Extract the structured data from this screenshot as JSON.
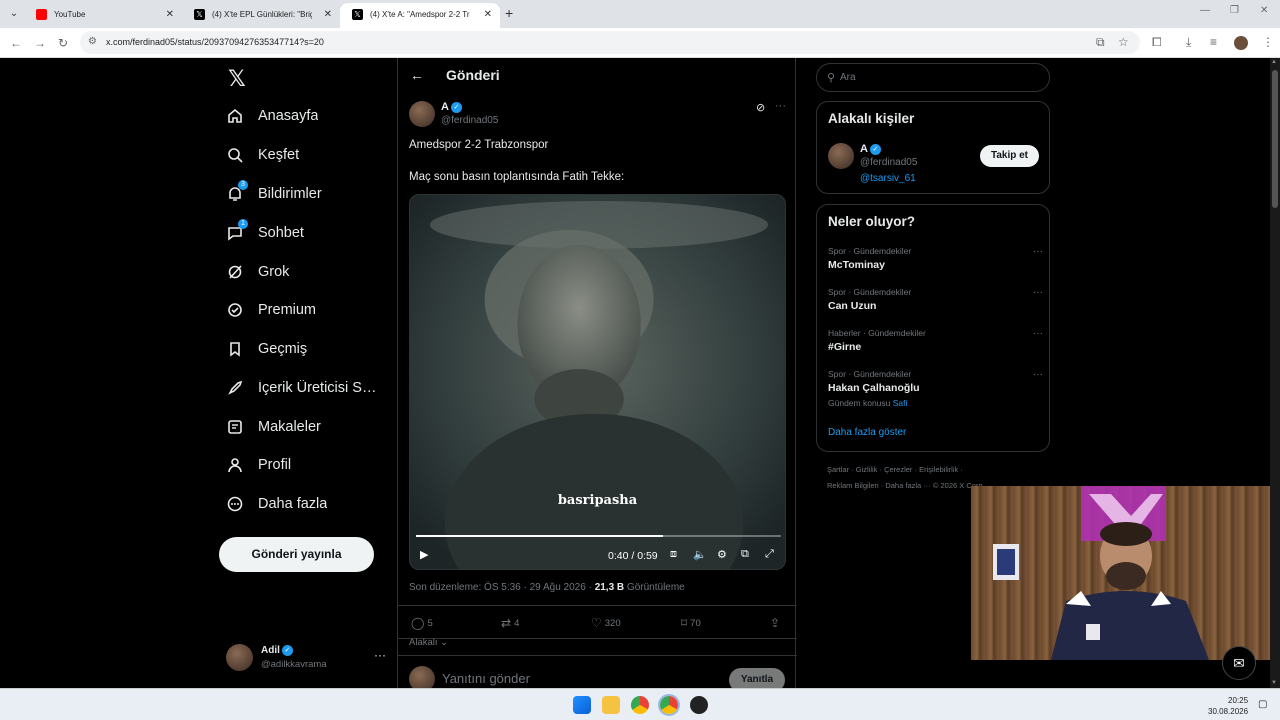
{
  "browser": {
    "tabs": [
      {
        "label": "YouTube",
        "active": false
      },
      {
        "label": "(4) X'te EPL Günlükleri: \"Brighto",
        "active": false
      },
      {
        "label": "(4) X'te A: \"Amedspor 2-2 Trab",
        "active": true
      }
    ],
    "url": "x.com/ferdinad05/status/2093709427635347714?s=20"
  },
  "sidebar": {
    "items": [
      {
        "label": "Anasayfa",
        "icon": "home-icon"
      },
      {
        "label": "Keşfet",
        "icon": "search-icon"
      },
      {
        "label": "Bildirimler",
        "icon": "bell-icon",
        "badge": "3"
      },
      {
        "label": "Sohbet",
        "icon": "chat-icon",
        "badge": "1"
      },
      {
        "label": "Grok",
        "icon": "grok-icon"
      },
      {
        "label": "Premium",
        "icon": "premium-icon"
      },
      {
        "label": "Geçmiş",
        "icon": "bookmark-icon"
      },
      {
        "label": "İçerik Üreticisi St...",
        "icon": "rocket-icon"
      },
      {
        "label": "Makaleler",
        "icon": "article-icon"
      },
      {
        "label": "Profil",
        "icon": "person-icon"
      },
      {
        "label": "Daha fazla",
        "icon": "more-circle-icon"
      }
    ],
    "post_button": "Gönderi yayınla",
    "me": {
      "name": "Adil",
      "handle": "@adilkkavrama"
    }
  },
  "main": {
    "header_title": "Gönderi",
    "author": {
      "name": "A",
      "handle": "@ferdinad05"
    },
    "text_line1": "Amedspor 2-2 Trabzonspor",
    "text_line2": "Maç sonu basın toplantısında Fatih Tekke:",
    "video": {
      "subtitle": "basripasha",
      "time": "0:40 / 0:59",
      "progress": 0.678
    },
    "meta_prefix": "Son düzenleme: ÖS 5:36 · 29 Ağu 2026 · ",
    "views": "21,3 B",
    "views_label": " Görüntüleme",
    "actions": {
      "replies": "5",
      "reposts": "4",
      "likes": "320",
      "bookmarks": "70"
    },
    "related_label": "Alakalı",
    "reply_placeholder": "Yanıtını gönder",
    "reply_button": "Yanıtla"
  },
  "right": {
    "search_placeholder": "Ara",
    "relevant": {
      "title": "Alakalı kişiler",
      "name": "A",
      "handle": "@ferdinad05",
      "link": "@tsarsiv_61",
      "follow_label": "Takip et"
    },
    "trends": {
      "title": "Neler oluyor?",
      "items": [
        {
          "category": "Spor · Gündemdekiler",
          "title": "McTominay"
        },
        {
          "category": "Spor · Gündemdekiler",
          "title": "Can Uzun"
        },
        {
          "category": "Haberler · Gündemdekiler",
          "title": "#Girne"
        },
        {
          "category": "Spor · Gündemdekiler",
          "title": "Hakan Çalhanoğlu",
          "sub_prefix": "Gündem konusu ",
          "sub_link": "Safi"
        }
      ],
      "show_more": "Daha fazla göster"
    },
    "footer": {
      "line1": "Şartlar  ·  Gizlilik  ·  Çerezler  ·  Erişilebilirlik  ·",
      "line2": "Reklam Bilgileri  ·  Daha fazla ···  © 2026 X Corp."
    }
  },
  "taskbar": {
    "time": "20:25",
    "date": "30.08.2026"
  },
  "colors": {
    "accent": "#1d9bf0",
    "background": "#000000",
    "border": "#2f3336",
    "muted": "#71767b"
  }
}
